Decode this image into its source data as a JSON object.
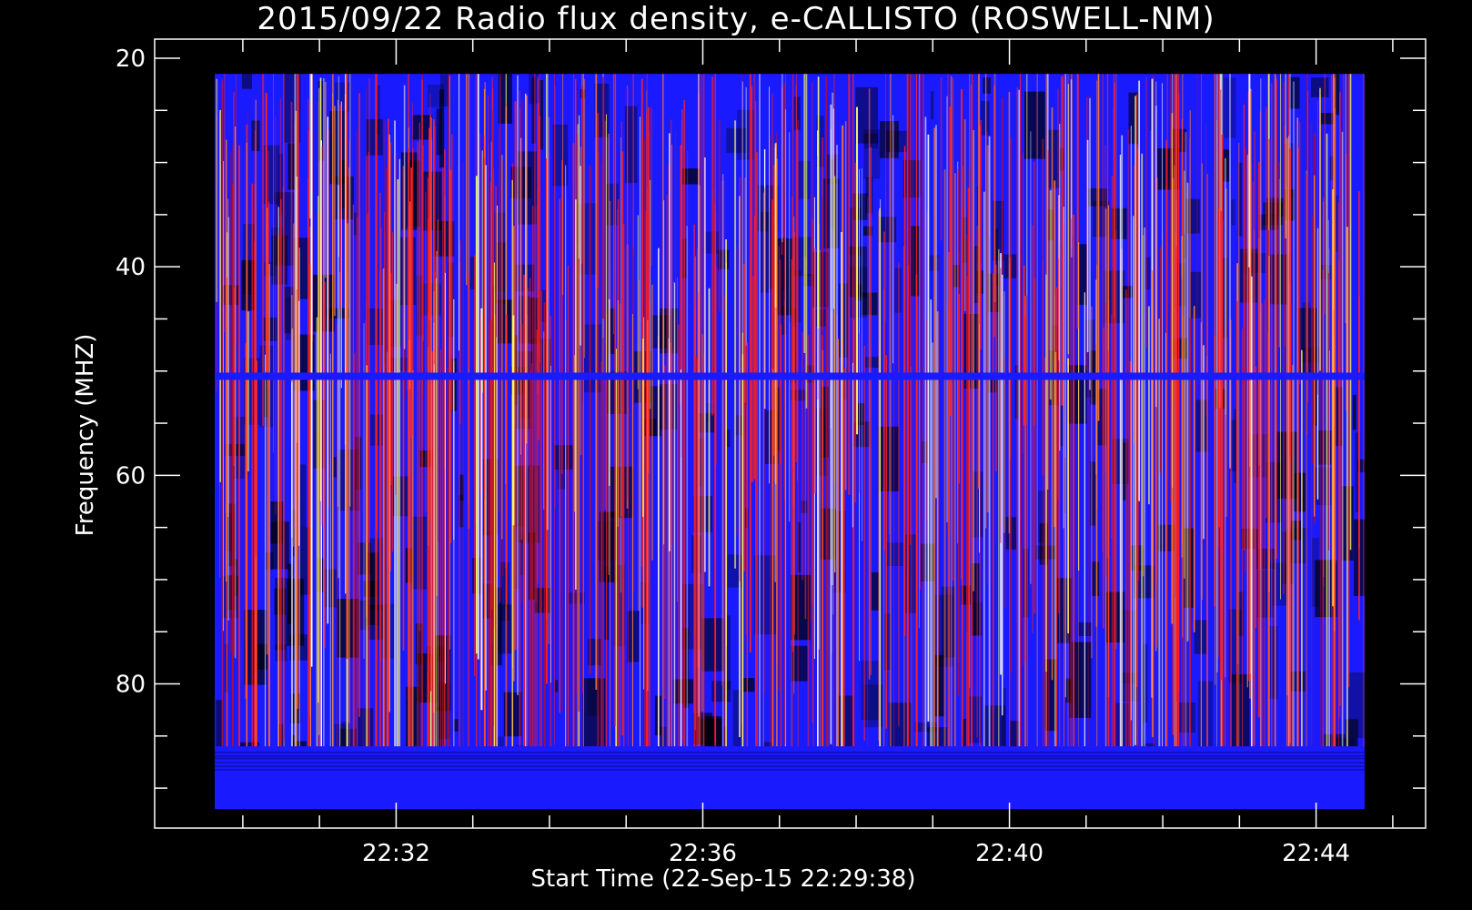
{
  "chart_data": {
    "type": "heatmap",
    "title": "2015/09/22  Radio flux density, e-CALLISTO (ROSWELL-NM)",
    "xlabel": "Start Time (22-Sep-15 22:29:38)",
    "ylabel": "Frequency (MHZ)",
    "x_tick_labels": [
      "22:32",
      "22:36",
      "22:40",
      "22:44"
    ],
    "y_tick_labels": [
      "20",
      "40",
      "60",
      "80"
    ],
    "x_range": [
      "22:29:38",
      "22:44:38"
    ],
    "ylim": [
      20,
      92
    ],
    "y_inverted": true,
    "colormap": [
      "#000000",
      "#1a1aff",
      "#ff2020",
      "#ffff60",
      "#ffffff"
    ],
    "features": [
      {
        "kind": "band",
        "freq_mhz": 50.5,
        "color": "#1a1aff"
      },
      {
        "kind": "band",
        "freq_mhz_range": [
          86,
          92
        ],
        "color": "#1a1aff"
      },
      {
        "kind": "band",
        "freq_mhz_range": [
          20,
          21.5
        ],
        "color": "#000000"
      }
    ]
  }
}
